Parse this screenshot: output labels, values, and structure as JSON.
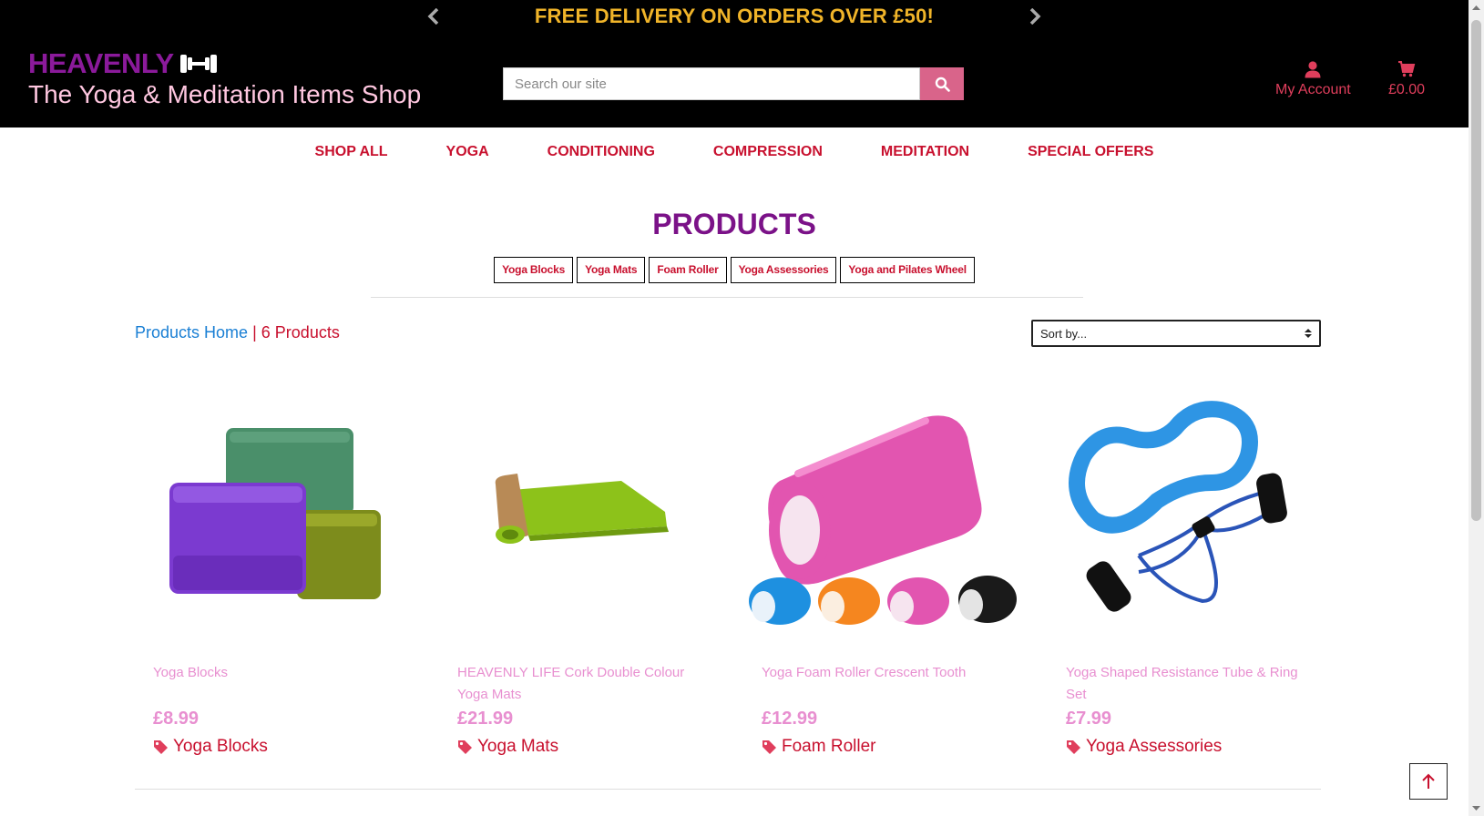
{
  "banner": {
    "text": "FREE DELIVERY ON ORDERS OVER £50!"
  },
  "brand": {
    "name": "HEAVENLY",
    "tagline": "The Yoga & Meditation Items Shop"
  },
  "search": {
    "placeholder": "Search our site"
  },
  "account": {
    "label": "My Account",
    "icon": "user-icon"
  },
  "bag": {
    "label": "£0.00",
    "icon": "shopping-cart-icon"
  },
  "nav": [
    "SHOP ALL",
    "YOGA",
    "CONDITIONING",
    "COMPRESSION",
    "MEDITATION",
    "SPECIAL OFFERS"
  ],
  "page": {
    "title": "PRODUCTS"
  },
  "categories": [
    "Yoga Blocks",
    "Yoga Mats",
    "Foam Roller",
    "Yoga Assessories",
    "Yoga and Pilates Wheel"
  ],
  "breadcrumb": {
    "home": "Products Home",
    "separator": "|",
    "count": "6 Products"
  },
  "sort": {
    "selected": "Sort by..."
  },
  "products": [
    {
      "name": "Yoga Blocks",
      "price": "£8.99",
      "category": "Yoga Blocks"
    },
    {
      "name": "HEAVENLY LIFE Cork Double Colour Yoga Mats",
      "price": "£21.99",
      "category": "Yoga Mats"
    },
    {
      "name": "Yoga Foam Roller Crescent Tooth",
      "price": "£12.99",
      "category": "Foam Roller"
    },
    {
      "name": "Yoga Shaped Resistance Tube & Ring Set",
      "price": "£7.99",
      "category": "Yoga Assessories"
    }
  ],
  "colors": {
    "accent": "#c8102e",
    "brand": "#8b1a9b",
    "banner_text": "#f0b429",
    "search_button": "#d9648a",
    "price": "#e88fd0"
  }
}
